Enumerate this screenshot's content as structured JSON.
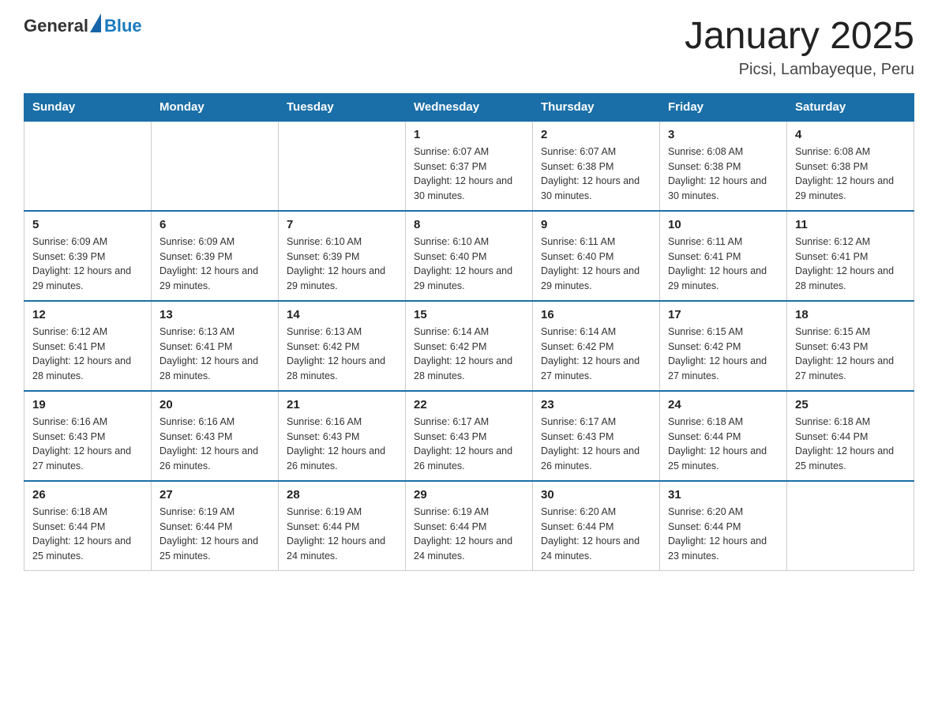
{
  "header": {
    "logo_general": "General",
    "logo_blue": "Blue",
    "month": "January 2025",
    "location": "Picsi, Lambayeque, Peru"
  },
  "columns": [
    "Sunday",
    "Monday",
    "Tuesday",
    "Wednesday",
    "Thursday",
    "Friday",
    "Saturday"
  ],
  "weeks": [
    [
      {
        "day": "",
        "info": ""
      },
      {
        "day": "",
        "info": ""
      },
      {
        "day": "",
        "info": ""
      },
      {
        "day": "1",
        "info": "Sunrise: 6:07 AM\nSunset: 6:37 PM\nDaylight: 12 hours\nand 30 minutes."
      },
      {
        "day": "2",
        "info": "Sunrise: 6:07 AM\nSunset: 6:38 PM\nDaylight: 12 hours\nand 30 minutes."
      },
      {
        "day": "3",
        "info": "Sunrise: 6:08 AM\nSunset: 6:38 PM\nDaylight: 12 hours\nand 30 minutes."
      },
      {
        "day": "4",
        "info": "Sunrise: 6:08 AM\nSunset: 6:38 PM\nDaylight: 12 hours\nand 29 minutes."
      }
    ],
    [
      {
        "day": "5",
        "info": "Sunrise: 6:09 AM\nSunset: 6:39 PM\nDaylight: 12 hours\nand 29 minutes."
      },
      {
        "day": "6",
        "info": "Sunrise: 6:09 AM\nSunset: 6:39 PM\nDaylight: 12 hours\nand 29 minutes."
      },
      {
        "day": "7",
        "info": "Sunrise: 6:10 AM\nSunset: 6:39 PM\nDaylight: 12 hours\nand 29 minutes."
      },
      {
        "day": "8",
        "info": "Sunrise: 6:10 AM\nSunset: 6:40 PM\nDaylight: 12 hours\nand 29 minutes."
      },
      {
        "day": "9",
        "info": "Sunrise: 6:11 AM\nSunset: 6:40 PM\nDaylight: 12 hours\nand 29 minutes."
      },
      {
        "day": "10",
        "info": "Sunrise: 6:11 AM\nSunset: 6:41 PM\nDaylight: 12 hours\nand 29 minutes."
      },
      {
        "day": "11",
        "info": "Sunrise: 6:12 AM\nSunset: 6:41 PM\nDaylight: 12 hours\nand 28 minutes."
      }
    ],
    [
      {
        "day": "12",
        "info": "Sunrise: 6:12 AM\nSunset: 6:41 PM\nDaylight: 12 hours\nand 28 minutes."
      },
      {
        "day": "13",
        "info": "Sunrise: 6:13 AM\nSunset: 6:41 PM\nDaylight: 12 hours\nand 28 minutes."
      },
      {
        "day": "14",
        "info": "Sunrise: 6:13 AM\nSunset: 6:42 PM\nDaylight: 12 hours\nand 28 minutes."
      },
      {
        "day": "15",
        "info": "Sunrise: 6:14 AM\nSunset: 6:42 PM\nDaylight: 12 hours\nand 28 minutes."
      },
      {
        "day": "16",
        "info": "Sunrise: 6:14 AM\nSunset: 6:42 PM\nDaylight: 12 hours\nand 27 minutes."
      },
      {
        "day": "17",
        "info": "Sunrise: 6:15 AM\nSunset: 6:42 PM\nDaylight: 12 hours\nand 27 minutes."
      },
      {
        "day": "18",
        "info": "Sunrise: 6:15 AM\nSunset: 6:43 PM\nDaylight: 12 hours\nand 27 minutes."
      }
    ],
    [
      {
        "day": "19",
        "info": "Sunrise: 6:16 AM\nSunset: 6:43 PM\nDaylight: 12 hours\nand 27 minutes."
      },
      {
        "day": "20",
        "info": "Sunrise: 6:16 AM\nSunset: 6:43 PM\nDaylight: 12 hours\nand 26 minutes."
      },
      {
        "day": "21",
        "info": "Sunrise: 6:16 AM\nSunset: 6:43 PM\nDaylight: 12 hours\nand 26 minutes."
      },
      {
        "day": "22",
        "info": "Sunrise: 6:17 AM\nSunset: 6:43 PM\nDaylight: 12 hours\nand 26 minutes."
      },
      {
        "day": "23",
        "info": "Sunrise: 6:17 AM\nSunset: 6:43 PM\nDaylight: 12 hours\nand 26 minutes."
      },
      {
        "day": "24",
        "info": "Sunrise: 6:18 AM\nSunset: 6:44 PM\nDaylight: 12 hours\nand 25 minutes."
      },
      {
        "day": "25",
        "info": "Sunrise: 6:18 AM\nSunset: 6:44 PM\nDaylight: 12 hours\nand 25 minutes."
      }
    ],
    [
      {
        "day": "26",
        "info": "Sunrise: 6:18 AM\nSunset: 6:44 PM\nDaylight: 12 hours\nand 25 minutes."
      },
      {
        "day": "27",
        "info": "Sunrise: 6:19 AM\nSunset: 6:44 PM\nDaylight: 12 hours\nand 25 minutes."
      },
      {
        "day": "28",
        "info": "Sunrise: 6:19 AM\nSunset: 6:44 PM\nDaylight: 12 hours\nand 24 minutes."
      },
      {
        "day": "29",
        "info": "Sunrise: 6:19 AM\nSunset: 6:44 PM\nDaylight: 12 hours\nand 24 minutes."
      },
      {
        "day": "30",
        "info": "Sunrise: 6:20 AM\nSunset: 6:44 PM\nDaylight: 12 hours\nand 24 minutes."
      },
      {
        "day": "31",
        "info": "Sunrise: 6:20 AM\nSunset: 6:44 PM\nDaylight: 12 hours\nand 23 minutes."
      },
      {
        "day": "",
        "info": ""
      }
    ]
  ]
}
